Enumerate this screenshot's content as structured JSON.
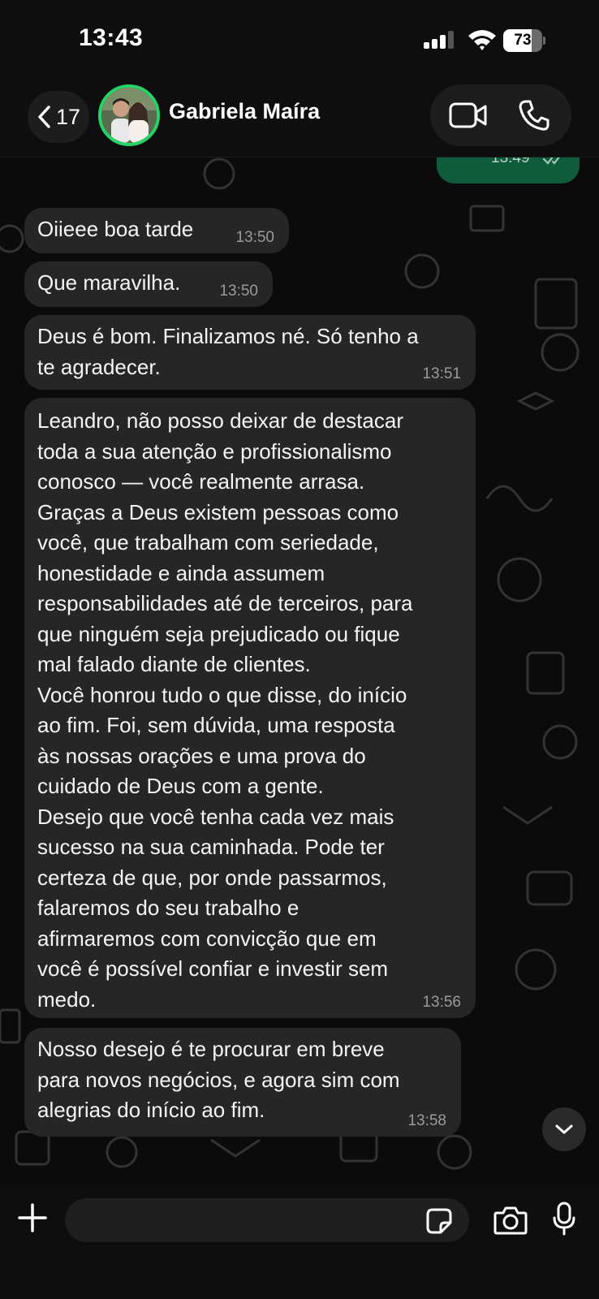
{
  "status_bar": {
    "time": "13:43",
    "battery_level": "73",
    "battery_fraction": 0.73
  },
  "header": {
    "back_count": "17",
    "contact_name": "Gabriela Maíra",
    "icons": [
      "chevron-left-icon",
      "video-camera-icon",
      "phone-icon"
    ]
  },
  "messages": [
    {
      "direction": "outgoing",
      "time": "13:49",
      "status": "read"
    },
    {
      "direction": "incoming",
      "text": "Oiieee boa tarde",
      "time": "13:50"
    },
    {
      "direction": "incoming",
      "text": "Que maravilha.",
      "time": "13:50"
    },
    {
      "direction": "incoming",
      "text": "Deus é bom. Finalizamos né. Só tenho a\nte agradecer.",
      "time": "13:51"
    },
    {
      "direction": "incoming",
      "text": "Leandro, não posso deixar de destacar\ntoda a sua atenção e profissionalismo\nconosco — você realmente arrasa.\nGraças a Deus existem pessoas como\nvocê, que trabalham com seriedade,\nhonestidade e ainda assumem\nresponsabilidades até de terceiros, para\nque ninguém seja prejudicado ou fique\nmal falado diante de clientes.\nVocê honrou tudo o que disse, do início\nao fim. Foi, sem dúvida, uma resposta\nàs nossas orações e uma prova do\ncuidado de Deus com a gente.\nDesejo que você tenha cada vez mais\nsucesso na sua caminhada. Pode ter\ncerteza de que, por onde passarmos,\nfalaremos do seu trabalho e\nafirmaremos com convicção que em\nvocê é possível confiar e investir sem\nmedo.",
      "time": "13:56"
    },
    {
      "direction": "incoming",
      "text": "Nosso desejo é te procurar em breve\npara novos negócios, e agora sim com\nalegrias do início ao fim.",
      "time": "13:58"
    }
  ],
  "composer": {
    "placeholder": "",
    "icons": [
      "plus-icon",
      "sticker-icon",
      "camera-icon",
      "microphone-icon"
    ]
  },
  "colors": {
    "incoming_bubble": "#262626",
    "outgoing_bubble": "#115b3d",
    "avatar_ring": "#25d366",
    "read_ticks": "#9fc9b4"
  }
}
